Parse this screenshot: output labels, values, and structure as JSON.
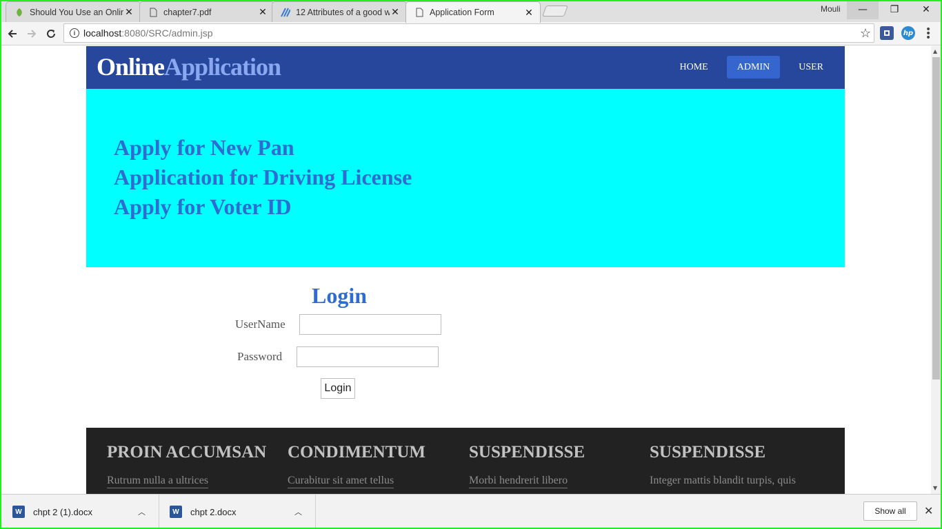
{
  "browser": {
    "tabs": [
      {
        "title": "Should You Use an Online",
        "icon": "leaf-icon"
      },
      {
        "title": "chapter7.pdf",
        "icon": "page-icon"
      },
      {
        "title": "12 Attributes of a good w",
        "icon": "stripes-icon"
      },
      {
        "title": "Application Form",
        "icon": "page-icon",
        "active": true
      }
    ],
    "user_name": "Mouli",
    "address_bar": {
      "host": "localhost",
      "path": ":8080/SRC/admin.jsp"
    }
  },
  "site": {
    "logo_part1": "Online",
    "logo_part2": "Application",
    "nav": [
      {
        "label": "HOME"
      },
      {
        "label": "ADMIN",
        "active": true
      },
      {
        "label": "USER"
      }
    ],
    "hero_links": [
      "Apply for New Pan",
      "Application for Driving License",
      "Apply for Voter ID"
    ]
  },
  "login": {
    "title": "Login",
    "username_label": "UserName",
    "username_value": "",
    "password_label": "Password",
    "password_value": "",
    "submit_label": "Login"
  },
  "footer": {
    "columns": [
      {
        "title": "PROIN ACCUMSAN",
        "item": "Rutrum nulla a ultrices",
        "is_link": true
      },
      {
        "title": "CONDIMENTUM",
        "item": "Curabitur sit amet tellus",
        "is_link": true
      },
      {
        "title": "SUSPENDISSE",
        "item": "Morbi hendrerit libero",
        "is_link": true
      },
      {
        "title": "SUSPENDISSE",
        "item": "Integer mattis blandit turpis, quis",
        "is_link": false
      }
    ]
  },
  "downloads": {
    "items": [
      {
        "file": "chpt 2 (1).docx"
      },
      {
        "file": "chpt 2.docx"
      }
    ],
    "show_all_label": "Show all"
  },
  "colors": {
    "header_bg": "#26479c",
    "nav_active_bg": "#3565cf",
    "hero_bg": "#00ffff",
    "link_blue": "#2e6cd1",
    "footer_bg": "#222222",
    "frame": "#22ee22"
  }
}
